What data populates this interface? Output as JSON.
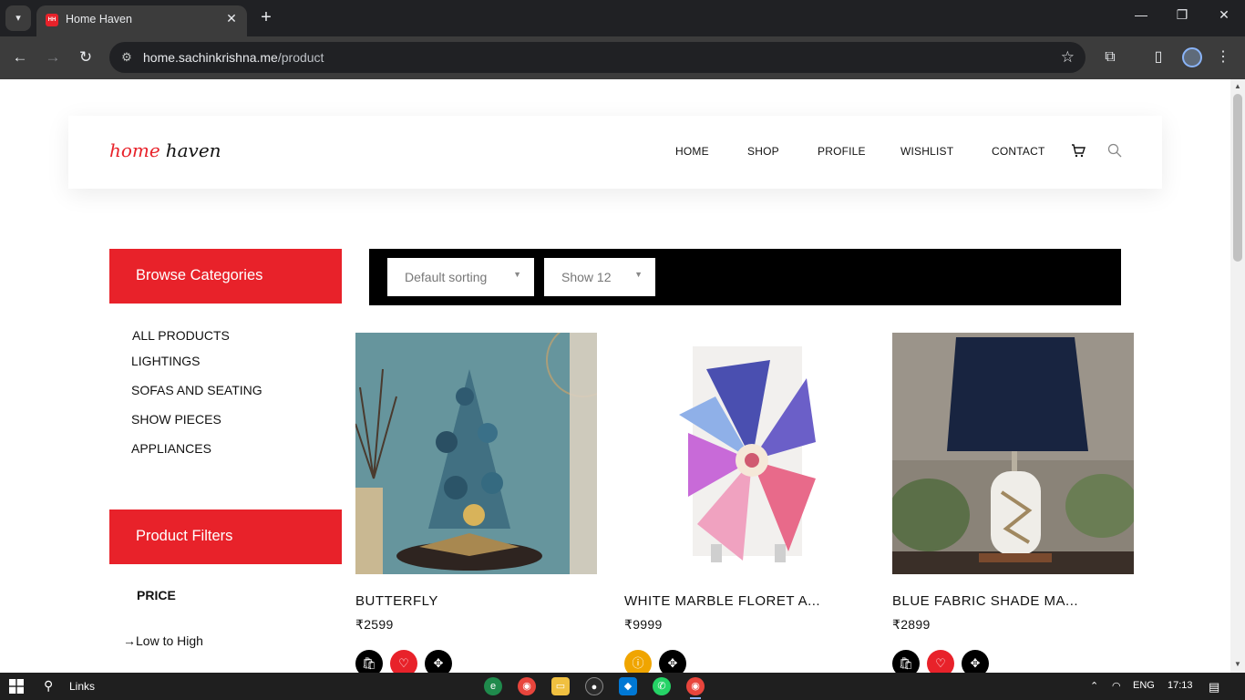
{
  "browser": {
    "tab_title": "Home Haven",
    "tab_favicon": "HH",
    "url_host": "home.sachinkrishna.me",
    "url_path": "/product"
  },
  "site": {
    "logo_part1": "home",
    "logo_part2": "haven",
    "nav": [
      "HOME",
      "SHOP",
      "PROFILE",
      "WISHLIST",
      "CONTACT"
    ]
  },
  "sidebar": {
    "categories_title": "Browse Categories",
    "categories": [
      "ALL PRODUCTS",
      "LIGHTINGS",
      "SOFAS AND SEATING",
      "SHOW PIECES",
      "APPLIANCES"
    ],
    "filters_title": "Product Filters",
    "price_heading": "PRICE",
    "price_option": "Low to High"
  },
  "sorting": {
    "sort_value": "Default sorting",
    "show_value": "Show 12"
  },
  "products": [
    {
      "name": "BUTTERFLY",
      "price": "₹2599"
    },
    {
      "name": "WHITE MARBLE FLORET A...",
      "price": "₹9999"
    },
    {
      "name": "BLUE FABRIC SHADE MA...",
      "price": "₹2899"
    }
  ],
  "taskbar": {
    "search_label": "Links",
    "language": "ENG",
    "time": "17:13"
  },
  "colors": {
    "brand_red": "#e8222a",
    "sortbar_bg": "#000000"
  }
}
